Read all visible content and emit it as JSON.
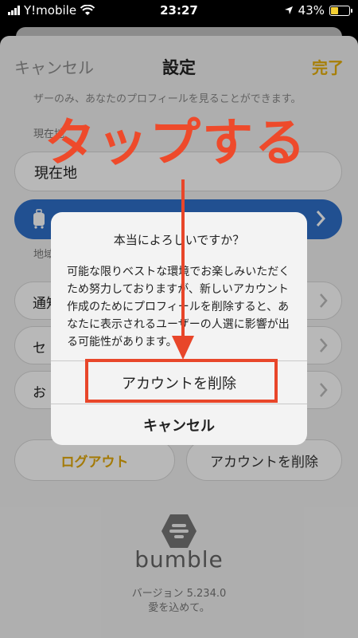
{
  "status_bar": {
    "carrier": "Y!mobile",
    "time": "23:27",
    "battery": "43%",
    "battery_level": 0.43
  },
  "nav": {
    "cancel": "キャンセル",
    "title": "設定",
    "done": "完了"
  },
  "settings": {
    "description": "ザーのみ、あなたのプロフィールを見ることができます。",
    "label_current": "現在地",
    "current_location": "現在地",
    "label_area": "地域",
    "rows": [
      "通知",
      "セ",
      "お"
    ],
    "logout": "ログアウト",
    "delete_account": "アカウントを削除"
  },
  "footer": {
    "brand": "bumble",
    "version": "バージョン 5.234.0",
    "love": "愛を込めて。"
  },
  "alert": {
    "title": "本当によろしいですか？",
    "message": "可能な限りベストな環境でお楽しみいただくため努力しておりますが、新しいアカウント作成のためにプロフィールを削除すると、あなたに表示されるユーザーの人選に影響が出る可能性があります。",
    "confirm": "アカウントを削除",
    "cancel": "キャンセル"
  },
  "annotation": {
    "text": "タップする"
  },
  "colors": {
    "accent": "#e8b00c",
    "travel": "#2f6fca",
    "annotation": "#ee4a2b"
  }
}
